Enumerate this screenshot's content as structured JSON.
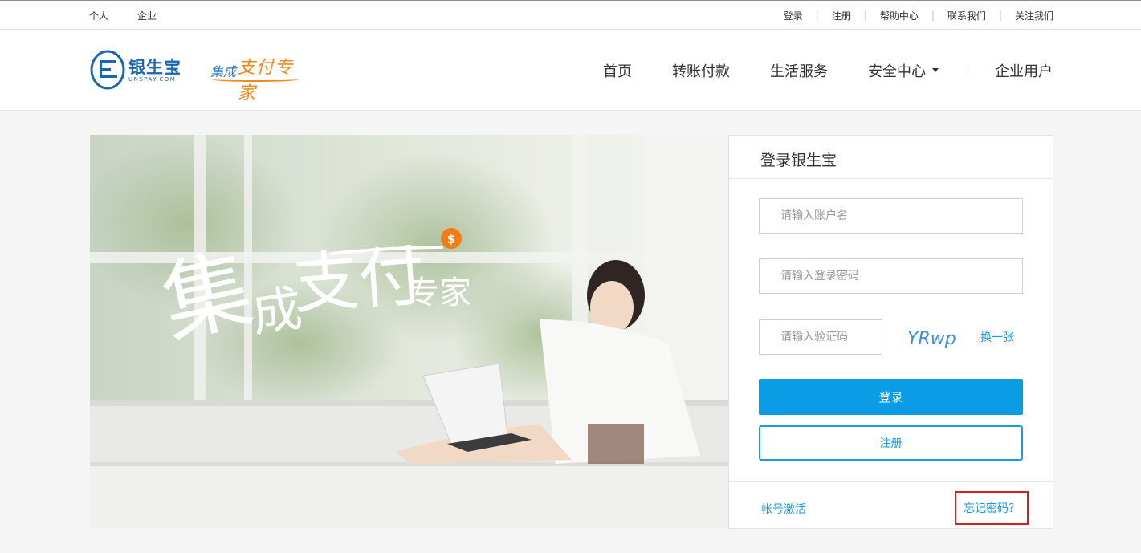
{
  "topbar": {
    "left": [
      "个人",
      "企业"
    ],
    "right": [
      "登录",
      "注册",
      "帮助中心",
      "联系我们",
      "关注我们"
    ],
    "separator": "|"
  },
  "header": {
    "logo_text": "银生宝",
    "logo_sub": "UNSPAY.COM",
    "slogan_part1": "集成",
    "slogan_part2": "支付专家",
    "nav": [
      "首页",
      "转账付款",
      "生活服务",
      "安全中心",
      "企业用户"
    ]
  },
  "banner": {
    "slogan_big1": "集",
    "slogan_big2": "成",
    "slogan_big3": "支付",
    "slogan_big4": "专家",
    "coin_symbol": "$"
  },
  "login": {
    "title": "登录银生宝",
    "username_placeholder": "请输入账户名",
    "password_placeholder": "请输入登录密码",
    "captcha_placeholder": "请输入验证码",
    "captcha_text": "YRwp",
    "captcha_refresh": "换一张",
    "login_button": "登录",
    "register_button": "注册",
    "activate_link": "帐号激活",
    "forgot_link": "忘记密码？"
  },
  "colors": {
    "brand_blue": "#1a66b3",
    "accent_blue": "#0a9de6",
    "link_blue": "#1a9ae0",
    "slogan_orange": "#f08a1c",
    "highlight_red": "#d62020"
  }
}
